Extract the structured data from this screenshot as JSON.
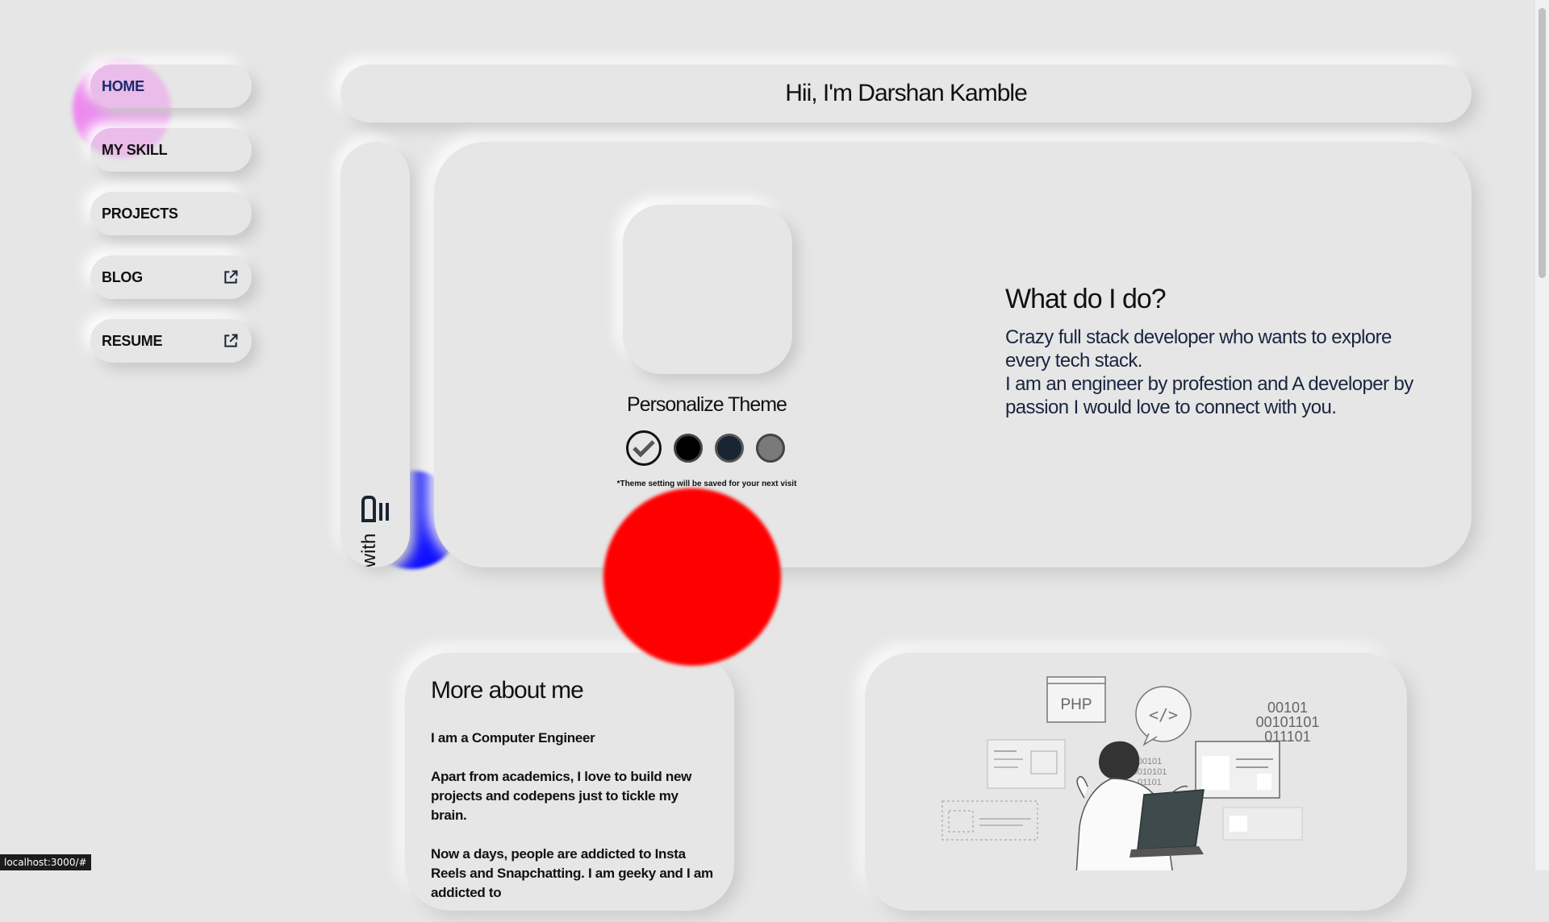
{
  "nav": {
    "items": [
      {
        "label": "HOME",
        "external": false
      },
      {
        "label": "MY SKILL",
        "external": false
      },
      {
        "label": "PROJECTS",
        "external": false
      },
      {
        "label": "BLOG",
        "external": true
      },
      {
        "label": "RESUME",
        "external": true
      }
    ]
  },
  "header": {
    "title": "Hii, I'm Darshan Kamble"
  },
  "coffee": {
    "text": "coffee with me?"
  },
  "theme": {
    "title": "Personalize Theme",
    "note": "*Theme setting will be saved for your next visit",
    "swatch_colors": [
      "#e6e6e6",
      "#000000",
      "#1a2533",
      "#7a7a7a"
    ]
  },
  "intro": {
    "title": "What do I do?",
    "line1": "Crazy full stack developer who wants to explore every tech stack.",
    "line2": "I am an engineer by profestion and A developer by passion I would love to connect with you."
  },
  "about": {
    "title": "More about me",
    "p1": "I am a Computer Engineer",
    "p2": "Apart from academics, I love to build new projects and codepens just to tickle my brain.",
    "p3": "Now a days, people are addicted to Insta Reels and Snapchatting. I am geeky and I am addicted to"
  },
  "illustration": {
    "php_label": "PHP",
    "binary1": "00101",
    "binary2": "00101101",
    "binary3": "011101",
    "binary_small1": "00101",
    "binary_small2": "0010101",
    "binary_small3": "01101"
  },
  "status_bar": {
    "url": "localhost:3000/#"
  }
}
